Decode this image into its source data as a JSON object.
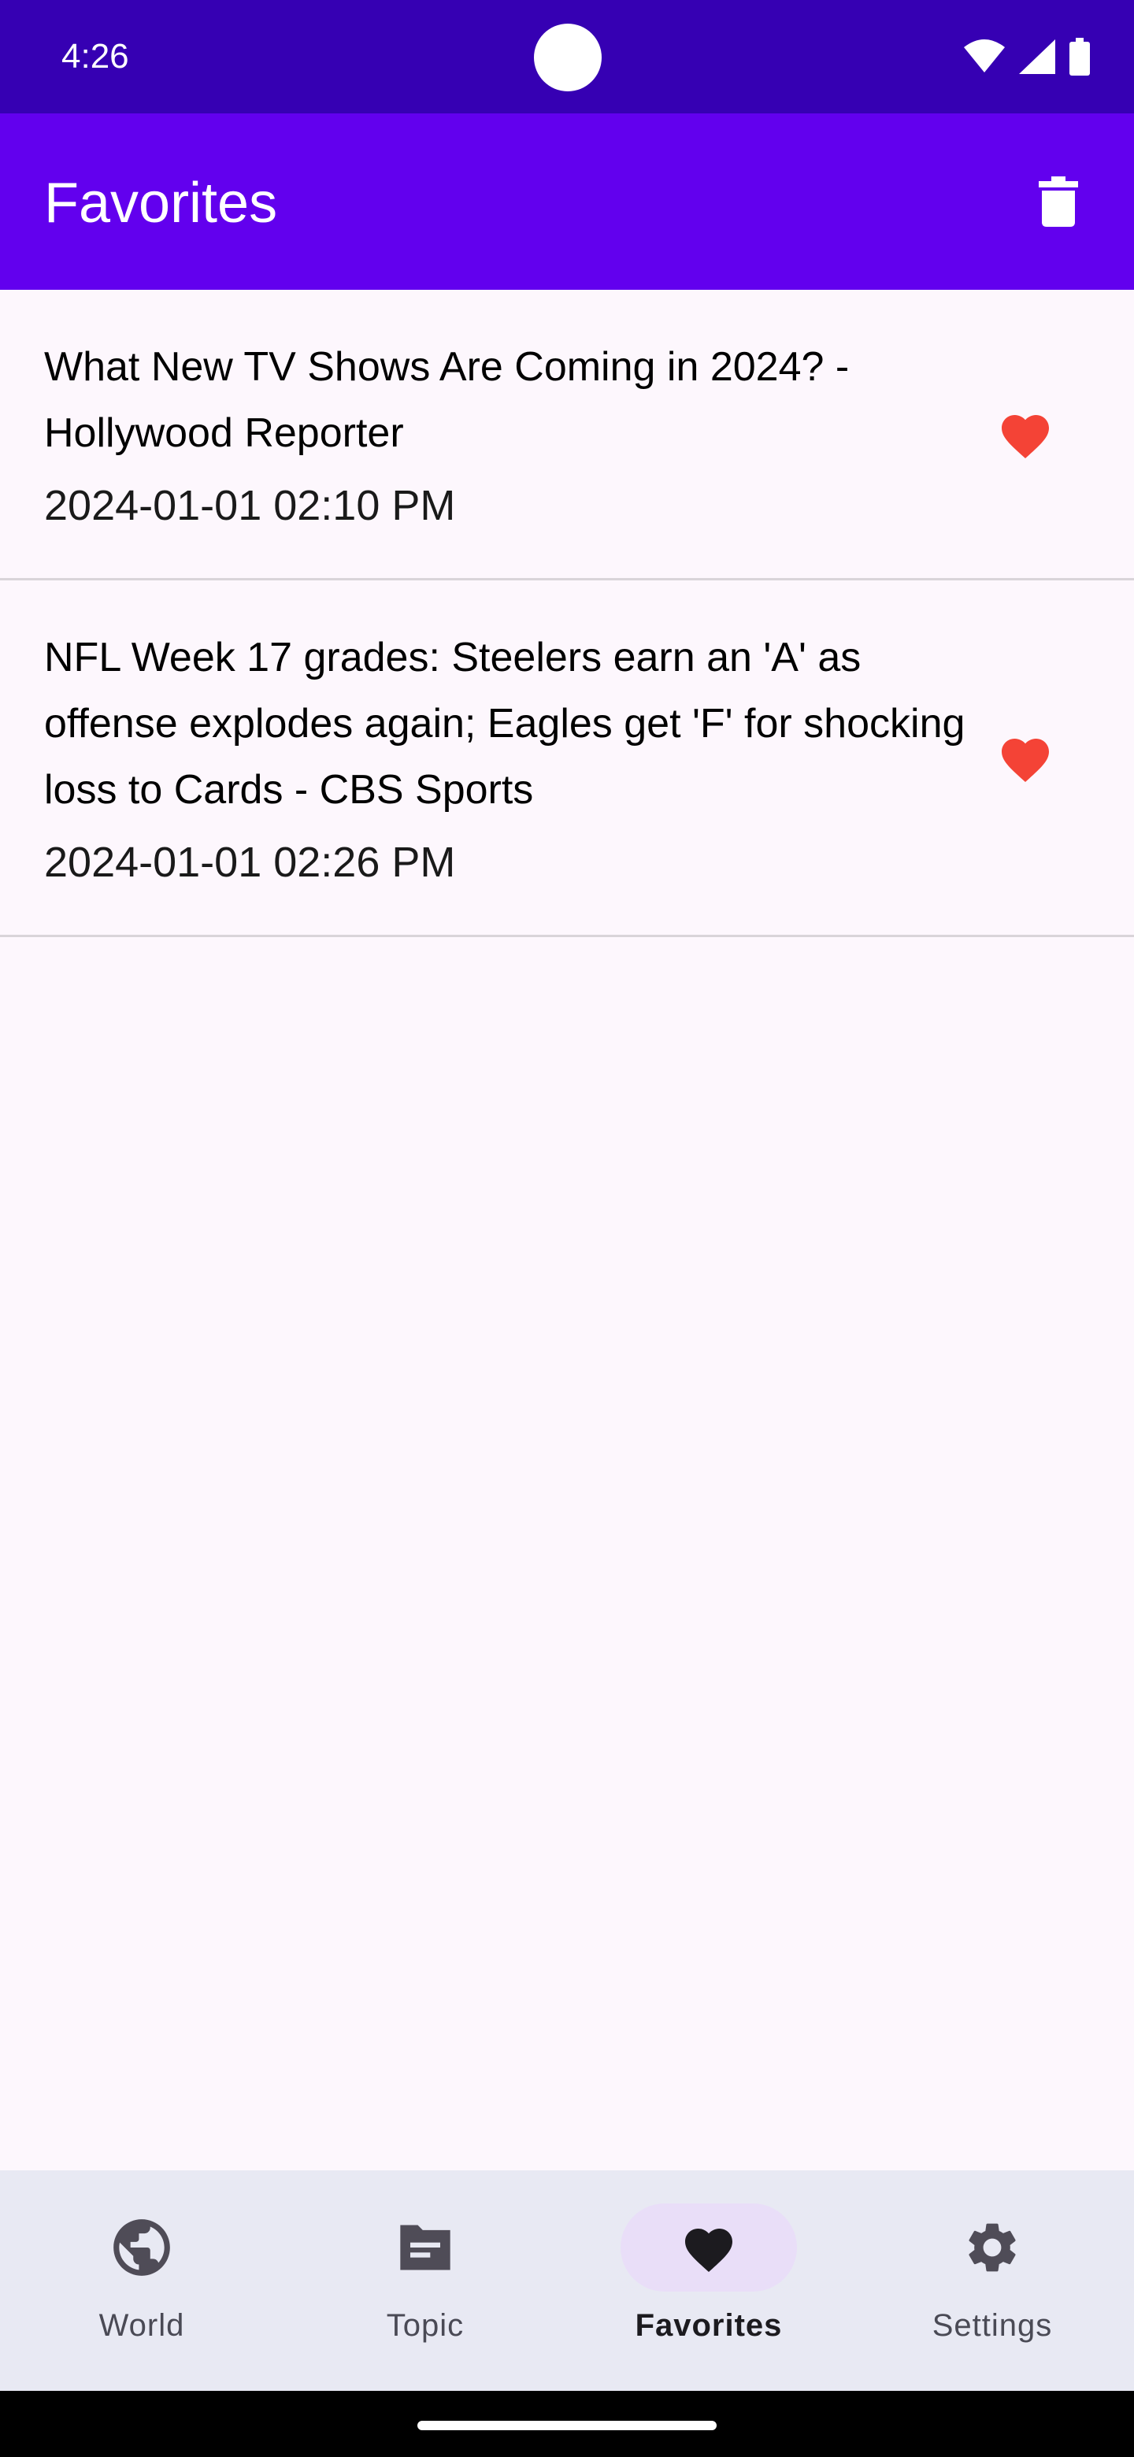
{
  "status_bar": {
    "time": "4:26",
    "icons": [
      "wifi-icon",
      "cellular-signal-icon",
      "battery-icon"
    ]
  },
  "app_bar": {
    "title": "Favorites",
    "action_icon": "trash-icon",
    "background": "#6200ee"
  },
  "articles": [
    {
      "title": "What New TV Shows Are Coming in 2024? - Hollywood Reporter",
      "date": "2024-01-01 02:10 PM",
      "favorite": true
    },
    {
      "title": "NFL Week 17 grades: Steelers earn an 'A' as offense explodes again; Eagles get 'F' for shocking loss to Cards - CBS Sports",
      "date": "2024-01-01 02:26 PM",
      "favorite": true
    }
  ],
  "bottom_nav": {
    "items": [
      {
        "label": "World",
        "icon": "globe-icon",
        "active": false
      },
      {
        "label": "Topic",
        "icon": "article-icon",
        "active": false
      },
      {
        "label": "Favorites",
        "icon": "heart-icon",
        "active": true
      },
      {
        "label": "Settings",
        "icon": "gear-icon",
        "active": false
      }
    ]
  },
  "colors": {
    "status_bar": "#3600b3",
    "app_bar": "#6200ee",
    "favorite_heart": "#f44336",
    "background": "#fdf7fd",
    "nav_background": "#e8e9f3",
    "nav_active_pill": "#e9def8"
  }
}
